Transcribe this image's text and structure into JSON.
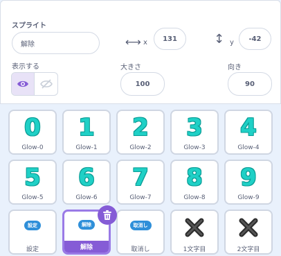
{
  "sprite": {
    "label": "スプライト",
    "name_value": "解除",
    "x_label": "x",
    "x_value": "131",
    "y_label": "y",
    "y_value": "-42",
    "show_label": "表示する",
    "size_label": "大きさ",
    "size_value": "100",
    "direction_label": "向き",
    "direction_value": "90",
    "visible": true
  },
  "costumes": [
    {
      "name": "Glow-0",
      "glyph": "0"
    },
    {
      "name": "Glow-1",
      "glyph": "1"
    },
    {
      "name": "Glow-2",
      "glyph": "2"
    },
    {
      "name": "Glow-3",
      "glyph": "3"
    },
    {
      "name": "Glow-4",
      "glyph": "4"
    },
    {
      "name": "Glow-5",
      "glyph": "5"
    },
    {
      "name": "Glow-6",
      "glyph": "6"
    },
    {
      "name": "Glow-7",
      "glyph": "7"
    },
    {
      "name": "Glow-8",
      "glyph": "8"
    },
    {
      "name": "Glow-9",
      "glyph": "9"
    },
    {
      "name": "設定",
      "badge": "設定"
    },
    {
      "name": "解除",
      "badge": "解除",
      "selected": true
    },
    {
      "name": "取消し",
      "badge": "取消し"
    },
    {
      "name": "1文字目",
      "icon": "x-mark-icon"
    },
    {
      "name": "2文字目",
      "icon": "x-mark-icon"
    }
  ],
  "colors": {
    "digit": "#1fd0c6",
    "digit_outline": "#0b9c95",
    "accent": "#855cd6",
    "badge": "#2f8fd9"
  }
}
